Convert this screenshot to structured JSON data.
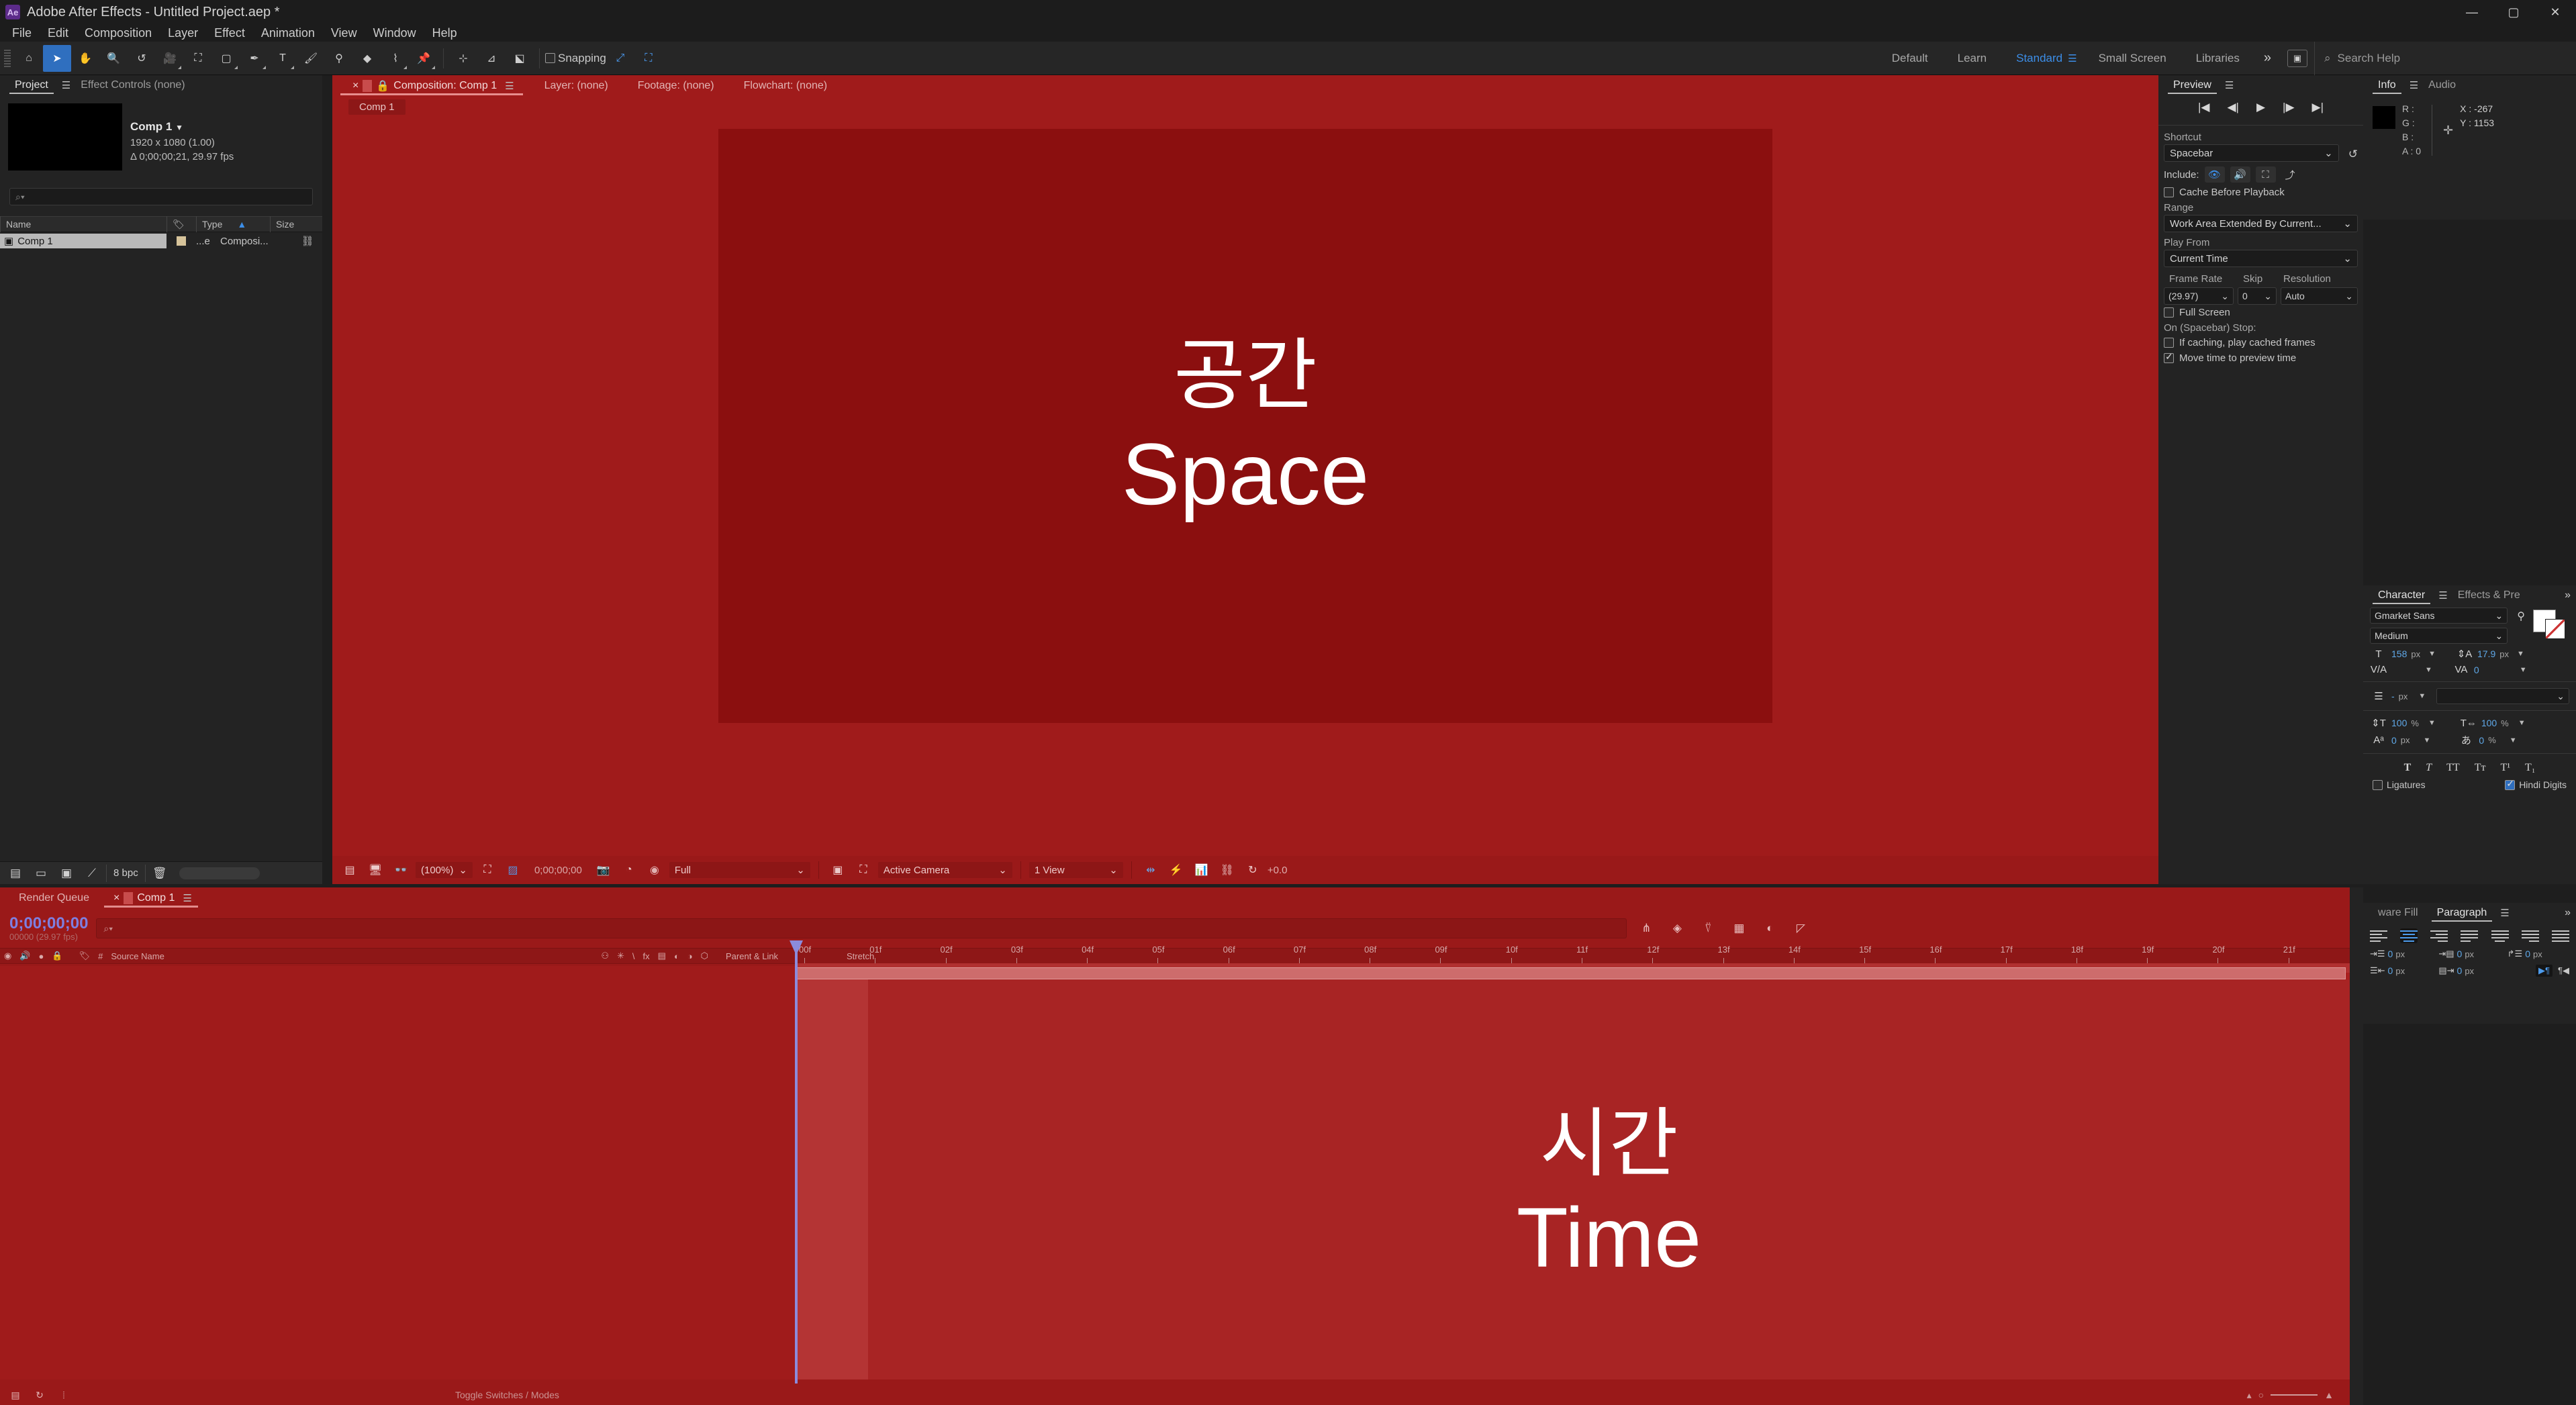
{
  "app": {
    "logo_text": "Ae",
    "title": "Adobe After Effects - Untitled Project.aep *",
    "window_buttons": [
      "—",
      "▢",
      "✕"
    ]
  },
  "menu": {
    "items": [
      "File",
      "Edit",
      "Composition",
      "Layer",
      "Effect",
      "Animation",
      "View",
      "Window",
      "Help"
    ]
  },
  "toolbar": {
    "tools": [
      {
        "name": "home-icon",
        "glyph": "⌂"
      },
      {
        "name": "selection-tool-icon",
        "glyph": "➤"
      },
      {
        "name": "hand-tool-icon",
        "glyph": "✋"
      },
      {
        "name": "zoom-tool-icon",
        "glyph": "🔍"
      },
      {
        "name": "rotation-tool-icon",
        "glyph": "↺"
      },
      {
        "name": "camera-tool-icon",
        "glyph": "🎥"
      },
      {
        "name": "pan-behind-tool-icon",
        "glyph": "⛶"
      },
      {
        "name": "shape-tool-icon",
        "glyph": "▢"
      },
      {
        "name": "pen-tool-icon",
        "glyph": "✒"
      },
      {
        "name": "type-tool-icon",
        "glyph": "T"
      },
      {
        "name": "brush-tool-icon",
        "glyph": "🖌"
      },
      {
        "name": "clone-stamp-tool-icon",
        "glyph": "⚲"
      },
      {
        "name": "eraser-tool-icon",
        "glyph": "◆"
      },
      {
        "name": "roto-brush-tool-icon",
        "glyph": "⌇"
      },
      {
        "name": "puppet-pin-tool-icon",
        "glyph": "📌"
      }
    ],
    "axis_tools": [
      {
        "name": "local-axis-icon",
        "glyph": "⊹"
      },
      {
        "name": "world-axis-icon",
        "glyph": "⊿"
      },
      {
        "name": "view-axis-icon",
        "glyph": "⬕"
      }
    ],
    "snapping_label": "Snapping",
    "snapping_checked": false,
    "extra_tools": [
      {
        "name": "snap-target-icon",
        "glyph": "⤢"
      },
      {
        "name": "transform-box-icon",
        "glyph": "⛶"
      }
    ]
  },
  "workspaces": {
    "items": [
      "Default",
      "Learn",
      "Standard",
      "Small Screen",
      "Libraries"
    ],
    "selected": "Standard",
    "overflow_glyph": "»",
    "layout_button_glyph": "▣",
    "search_placeholder": "Search Help",
    "search_icon": "search-icon",
    "accent": "#3c8ee8"
  },
  "project_panel": {
    "tabs": [
      {
        "label": "Project",
        "selected": true
      },
      {
        "label": "Effect Controls  (none)",
        "selected": false
      }
    ],
    "item": {
      "name": "Comp 1",
      "resolution": "1920 x 1080 (1.00)",
      "duration": "Δ 0;00;00;21, 29.97 fps"
    },
    "search_placeholder": "",
    "columns": [
      "Name",
      "Type",
      "Size"
    ],
    "tag_column_icon": "tag-icon",
    "sort_icon": "sort-asc-icon",
    "rows": [
      {
        "name": "Comp 1",
        "label_color": "#d6c39a",
        "type_short": "...e",
        "type": "Composi...",
        "icon": "composition-icon"
      }
    ],
    "bottom_bar": {
      "bit_depth": "8 bpc",
      "buttons": [
        {
          "name": "interpret-footage-icon",
          "glyph": "▤"
        },
        {
          "name": "new-folder-icon",
          "glyph": "▭"
        },
        {
          "name": "new-composition-icon",
          "glyph": "▣"
        },
        {
          "name": "project-settings-icon",
          "glyph": "⟋"
        },
        {
          "name": "delete-icon",
          "glyph": "🗑"
        }
      ]
    }
  },
  "composition_panel": {
    "tabs": [
      {
        "label": "Composition: Comp 1",
        "selected": true,
        "close_glyph": "×",
        "lock_icon": "lock-icon"
      },
      {
        "label": "Layer: (none)",
        "selected": false
      },
      {
        "label": "Footage: (none)",
        "selected": false
      },
      {
        "label": "Flowchart: (none)",
        "selected": false
      }
    ],
    "breadcrumb_chip": "Comp 1",
    "canvas": {
      "background": "#8b0f0f",
      "line_korean": "공간",
      "line_english": "Space"
    },
    "viewer_bar": {
      "zoom": "(100%)",
      "current_time": "0;00;00;00",
      "resolution": "Full",
      "camera": "Active Camera",
      "views": "1 View",
      "exposure": "+0.0",
      "icons": [
        {
          "name": "always-preview-icon",
          "glyph": "▤"
        },
        {
          "name": "main-viewer-icon",
          "glyph": "🖥"
        },
        {
          "name": "3d-glasses-icon",
          "glyph": "👓"
        },
        {
          "name": "region-of-interest-icon",
          "glyph": "⛶"
        },
        {
          "name": "transparency-grid-icon",
          "glyph": "▨"
        },
        {
          "name": "take-snapshot-icon",
          "glyph": "📷"
        },
        {
          "name": "show-snapshot-icon",
          "glyph": "◔"
        },
        {
          "name": "channel-rgb-icon",
          "glyph": "◉"
        },
        {
          "name": "mask-visibility-icon",
          "glyph": "▣"
        },
        {
          "name": "guides-icon",
          "glyph": "⛶"
        },
        {
          "name": "pixel-aspect-correction-icon",
          "glyph": "⇹"
        },
        {
          "name": "fast-previews-icon",
          "glyph": "⚡"
        },
        {
          "name": "timeline-icon",
          "glyph": "📊"
        },
        {
          "name": "comp-flowchart-icon",
          "glyph": "⛓"
        },
        {
          "name": "reset-exposure-icon",
          "glyph": "↻"
        }
      ]
    }
  },
  "preview_panel": {
    "title": "Preview",
    "transport": [
      {
        "name": "first-frame-button",
        "glyph": "|◀"
      },
      {
        "name": "previous-frame-button",
        "glyph": "◀|"
      },
      {
        "name": "play-button",
        "glyph": "▶"
      },
      {
        "name": "next-frame-button",
        "glyph": "|▶"
      },
      {
        "name": "last-frame-button",
        "glyph": "▶|"
      }
    ],
    "shortcut_label": "Shortcut",
    "shortcut_value": "Spacebar",
    "reset_icon": "reset-icon",
    "include_label": "Include:",
    "include_buttons": [
      {
        "name": "include-video-icon",
        "glyph": "👁"
      },
      {
        "name": "include-audio-icon",
        "glyph": "🔊"
      },
      {
        "name": "include-overlays-icon",
        "glyph": "⛶"
      }
    ],
    "export_icon": "export-icon",
    "cache_before_playback_label": "Cache Before Playback",
    "cache_before_playback_checked": false,
    "range_label": "Range",
    "range_value": "Work Area Extended By Current...",
    "play_from_label": "Play From",
    "play_from_value": "Current Time",
    "frame_rate_label": "Frame Rate",
    "frame_rate_value": "(29.97)",
    "skip_label": "Skip",
    "skip_value": "0",
    "resolution_label": "Resolution",
    "resolution_value": "Auto",
    "full_screen_label": "Full Screen",
    "full_screen_checked": false,
    "on_stop_label": "On (Spacebar) Stop:",
    "if_caching_label": "If caching, play cached frames",
    "if_caching_checked": false,
    "move_time_label": "Move time to preview time",
    "move_time_checked": true
  },
  "info_panel": {
    "tabs": [
      {
        "label": "Info",
        "selected": true
      },
      {
        "label": "Audio",
        "selected": false
      }
    ],
    "channels": [
      {
        "label": "R :",
        "value": ""
      },
      {
        "label": "G :",
        "value": ""
      },
      {
        "label": "B :",
        "value": ""
      },
      {
        "label": "A :",
        "value": "0"
      }
    ],
    "coords": [
      {
        "label": "X :",
        "value": "-267"
      },
      {
        "label": "Y :",
        "value": "1153"
      }
    ],
    "swatch_color": "#000000"
  },
  "character_panel": {
    "tabs": [
      {
        "label": "Character",
        "selected": true
      },
      {
        "label": "Effects & Pre",
        "selected": false
      }
    ],
    "overflow_glyph": "»",
    "font_family": "Gmarket Sans",
    "font_style": "Medium",
    "eyedropper_icon": "eyedropper-icon",
    "fill_color": "#ffffff",
    "stroke_color": "none",
    "font_size": {
      "icon": "font-size-icon",
      "value": "158",
      "unit": "px"
    },
    "leading": {
      "icon": "leading-icon",
      "value": "17.9",
      "unit": "px"
    },
    "kerning": {
      "icon": "kerning-icon",
      "value": "",
      "unit": ""
    },
    "tracking": {
      "icon": "tracking-icon",
      "value": "0",
      "unit": ""
    },
    "stroke_width": {
      "icon": "stroke-width-icon",
      "value": "-",
      "unit": "px"
    },
    "stroke_type": "",
    "vertical_scale": {
      "icon": "vertical-scale-icon",
      "value": "100",
      "unit": "%"
    },
    "horizontal_scale": {
      "icon": "horizontal-scale-icon",
      "value": "100",
      "unit": "%"
    },
    "baseline_shift": {
      "icon": "baseline-shift-icon",
      "value": "0",
      "unit": "px"
    },
    "tsume": {
      "icon": "tsume-icon",
      "value": "0",
      "unit": "%"
    },
    "style_buttons": [
      "T",
      "T",
      "TT",
      "Tᴛ",
      "T¹",
      "T₁"
    ],
    "ligatures_label": "Ligatures",
    "ligatures_checked": false,
    "hindi_digits_label": "Hindi Digits",
    "hindi_digits_checked": true
  },
  "paragraph_panel": {
    "tabs": [
      {
        "label": "ware Fill",
        "selected": false
      },
      {
        "label": "Paragraph",
        "selected": true
      }
    ],
    "overflow_glyph": "»",
    "align_buttons": [
      "align-left",
      "align-center",
      "align-right",
      "justify-last-left",
      "justify-last-center",
      "justify-last-right",
      "justify-all"
    ],
    "align_selected_index": 1,
    "indents": [
      {
        "icon": "indent-left-icon",
        "value": "0",
        "unit": "px"
      },
      {
        "icon": "space-before-icon",
        "value": "0",
        "unit": "px"
      },
      {
        "icon": "indent-first-line-icon",
        "value": "0",
        "unit": "px"
      },
      {
        "icon": "indent-right-icon",
        "value": "0",
        "unit": "px"
      },
      {
        "icon": "space-after-icon",
        "value": "0",
        "unit": "px"
      }
    ],
    "direction_ltr_icon": "paragraph-ltr-icon",
    "direction_rtl_icon": "paragraph-rtl-icon"
  },
  "timeline_panel": {
    "tabs": [
      {
        "label": "Render Queue",
        "selected": false
      },
      {
        "label": "Comp 1",
        "selected": true,
        "close_glyph": "×"
      }
    ],
    "current_time": "0;00;00;00",
    "current_frame": "00000 (29.97 fps)",
    "search_placeholder": "",
    "tool_icons": [
      {
        "name": "composition-mini-flowchart-icon",
        "glyph": "⋔"
      },
      {
        "name": "draft-3d-icon",
        "glyph": "◈"
      },
      {
        "name": "hide-shy-layers-icon",
        "glyph": "⍢"
      },
      {
        "name": "frame-blending-icon",
        "glyph": "▦"
      },
      {
        "name": "motion-blur-icon",
        "glyph": "◐"
      },
      {
        "name": "graph-editor-icon",
        "glyph": "◸"
      }
    ],
    "column_headers": [
      {
        "name": "video-switch-icon",
        "glyph": "◉"
      },
      {
        "name": "audio-switch-icon",
        "glyph": "🔊"
      },
      {
        "name": "solo-switch-icon",
        "glyph": "●"
      },
      {
        "name": "lock-switch-icon",
        "glyph": "🔒"
      },
      {
        "name": "label-column-icon",
        "glyph": "🏷"
      },
      {
        "name": "layer-number-label",
        "glyph": "#"
      },
      {
        "name": "source-name-label",
        "glyph": "Source Name"
      },
      {
        "name": "shy-icon",
        "glyph": "⚇"
      },
      {
        "name": "collapse-transform-icon",
        "glyph": "✳"
      },
      {
        "name": "quality-icon",
        "glyph": "\\"
      },
      {
        "name": "effects-icon",
        "glyph": "fx"
      },
      {
        "name": "frame-blend-icon",
        "glyph": "▤"
      },
      {
        "name": "motion-blur-col-icon",
        "glyph": "◐"
      },
      {
        "name": "adjustment-layer-icon",
        "glyph": "◑"
      },
      {
        "name": "3d-layer-icon",
        "glyph": "⬡"
      },
      {
        "name": "parent-link-label",
        "glyph": "Parent & Link"
      },
      {
        "name": "stretch-label",
        "glyph": "Stretch"
      }
    ],
    "ruler_ticks": [
      "00f",
      "01f",
      "02f",
      "03f",
      "04f",
      "05f",
      "06f",
      "07f",
      "08f",
      "09f",
      "10f",
      "11f",
      "12f",
      "13f",
      "14f",
      "15f",
      "16f",
      "17f",
      "18f",
      "19f",
      "20f",
      "21f"
    ],
    "overlay": {
      "line_korean": "시간",
      "line_english": "Time"
    },
    "bottom": {
      "toggle_label": "Toggle Switches / Modes",
      "icons": [
        {
          "name": "frame-render-time-icon",
          "glyph": "▤"
        },
        {
          "name": "comp-render-icon",
          "glyph": "↻"
        },
        {
          "name": "motion-blur-footer-icon",
          "glyph": "⦙"
        }
      ],
      "zoom_out_glyph": "▴",
      "zoom_in_glyph": "▲",
      "zoom_handle_glyph": "○"
    }
  },
  "colors": {
    "window_bg": "#1c1c1c",
    "panel_bg": "#232323",
    "accent_blue": "#3c8ee8",
    "comp_red": "#a01b1b",
    "canvas_red": "#8b0f0f",
    "timeline_red": "#9a1919",
    "playhead_blue": "#8b8bdc"
  }
}
